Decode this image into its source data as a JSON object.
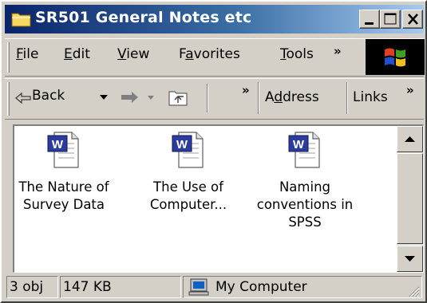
{
  "window": {
    "title": "SR501 General Notes etc"
  },
  "menubar": {
    "items": [
      {
        "label": "File",
        "accel": "F",
        "rest": "ile"
      },
      {
        "label": "Edit",
        "accel": "E",
        "rest": "dit"
      },
      {
        "label": "View",
        "accel": "V",
        "rest": "iew"
      },
      {
        "label": "Favorites",
        "pre": "F",
        "accel": "a",
        "rest": "vorites"
      },
      {
        "label": "Tools",
        "accel": "T",
        "rest": "ools"
      }
    ],
    "overflow": "»"
  },
  "toolbar": {
    "back_label": "Back",
    "overflow": "»",
    "address_pre": "A",
    "address_accel": "d",
    "address_rest": "dress",
    "links_label": "Links",
    "links_overflow": "»"
  },
  "files": [
    {
      "label": "The Nature of\nSurvey Data",
      "icon": "word-document-icon"
    },
    {
      "label": "The Use of\nComputer...",
      "icon": "word-document-icon"
    },
    {
      "label": "Naming\nconventions in\nSPSS",
      "icon": "word-document-icon"
    }
  ],
  "statusbar": {
    "objects": "3 obj",
    "size": "147 KB",
    "zone": "My Computer"
  },
  "colors": {
    "title_start": "#0a246a",
    "title_end": "#a6caf0",
    "face": "#d4d0c8",
    "word_blue": "#2b3c9e"
  }
}
